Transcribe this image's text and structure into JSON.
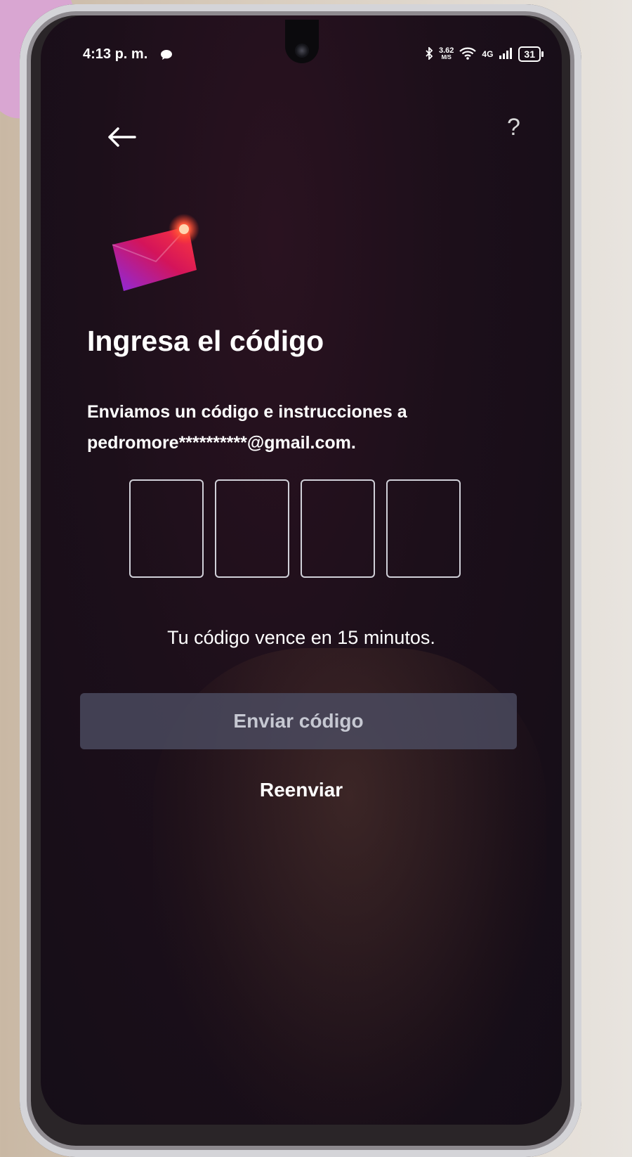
{
  "status_bar": {
    "time": "4:13 p. m.",
    "net_speed": "3.62",
    "net_speed_unit": "M/S",
    "network_type": "4G",
    "battery_level": "31"
  },
  "screen": {
    "title": "Ingresa el código",
    "subtitle_line1": "Enviamos un código e instrucciones a",
    "subtitle_line2": "pedromore**********@gmail.com.",
    "code_boxes": [
      "",
      "",
      "",
      ""
    ],
    "expiry_text": "Tu código vence en 15 minutos.",
    "send_button_label": "Enviar código",
    "resend_label": "Reenviar"
  },
  "icons": {
    "back": "arrow-left-icon",
    "help": "question-mark-icon",
    "envelope": "envelope-icon",
    "chat": "chat-bubble-icon"
  },
  "colors": {
    "background": "#1c0f1a",
    "text": "#ffffff",
    "button_bg": "#4c4c60",
    "button_text": "#c6c8d2",
    "envelope_gradient_start": "#8a2be2",
    "envelope_gradient_end": "#ff3b3b"
  }
}
